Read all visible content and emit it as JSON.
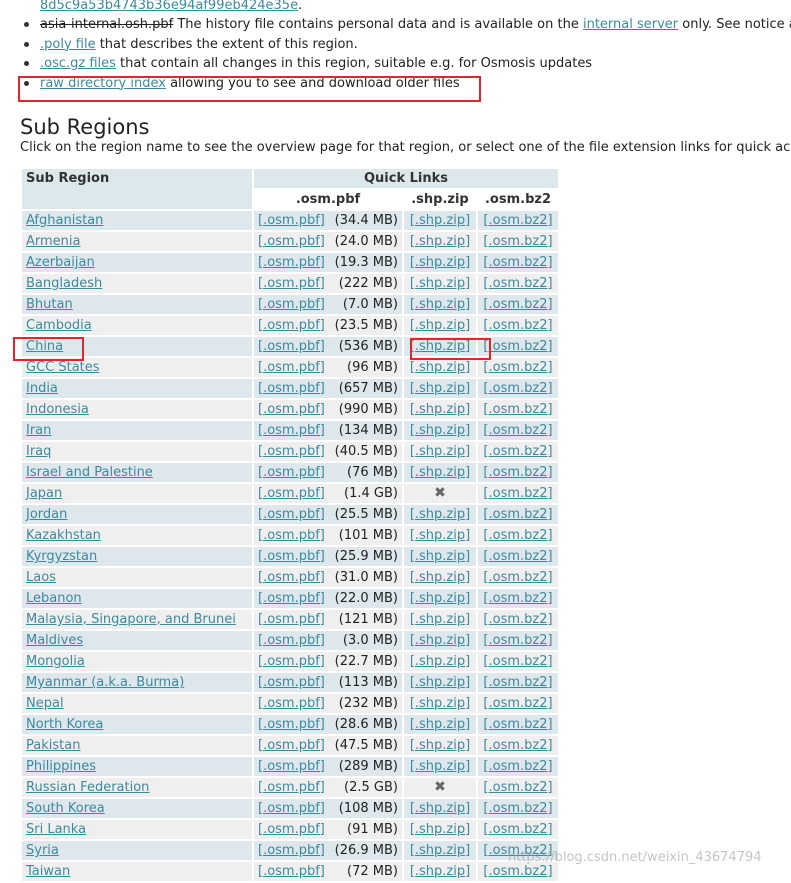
{
  "bullets": {
    "hash_line": "8d5c9a53b4743b36e94af99eb424e35e",
    "hash_period": ".",
    "history_file": "asia-internal.osh.pbf",
    "history_text_a": " The history file contains personal data and is available on the ",
    "internal_server": "internal server",
    "history_text_b": " only. See notice a",
    "poly_link": ".poly file",
    "poly_text": " that describes the extent of this region.",
    "osc_link": ".osc.gz files",
    "osc_text": " that contain all changes in this region, suitable e.g. for Osmosis updates",
    "raw_link": "raw directory index",
    "raw_text": " allowing you to see and download older files"
  },
  "heading": "Sub Regions",
  "intro": "Click on the region name to see the overview page for that region, or select one of the file extension links for quick acc",
  "table": {
    "col_sub_region": "Sub Region",
    "col_quick_links": "Quick Links",
    "col_pbf": ".osm.pbf",
    "col_shp": ".shp.zip",
    "col_bz2": ".osm.bz2",
    "pbf_link": "[.osm.pbf]",
    "shp_link": "[.shp.zip]",
    "bz2_link": "[.osm.bz2]",
    "rows": [
      {
        "name": "Afghanistan",
        "size": "(34.4 MB)",
        "shp": true
      },
      {
        "name": "Armenia",
        "size": "(24.0 MB)",
        "shp": true
      },
      {
        "name": "Azerbaijan",
        "size": "(19.3 MB)",
        "shp": true
      },
      {
        "name": "Bangladesh",
        "size": "(222 MB)",
        "shp": true
      },
      {
        "name": "Bhutan",
        "size": "(7.0 MB)",
        "shp": true
      },
      {
        "name": "Cambodia",
        "size": "(23.5 MB)",
        "shp": true
      },
      {
        "name": "China",
        "size": "(536 MB)",
        "shp": true
      },
      {
        "name": "GCC States",
        "size": "(96 MB)",
        "shp": true
      },
      {
        "name": "India",
        "size": "(657 MB)",
        "shp": true
      },
      {
        "name": "Indonesia",
        "size": "(990 MB)",
        "shp": true
      },
      {
        "name": "Iran",
        "size": "(134 MB)",
        "shp": true
      },
      {
        "name": "Iraq",
        "size": "(40.5 MB)",
        "shp": true
      },
      {
        "name": "Israel and Palestine",
        "size": "(76 MB)",
        "shp": true
      },
      {
        "name": "Japan",
        "size": "(1.4 GB)",
        "shp": false
      },
      {
        "name": "Jordan",
        "size": "(25.5 MB)",
        "shp": true
      },
      {
        "name": "Kazakhstan",
        "size": "(101 MB)",
        "shp": true
      },
      {
        "name": "Kyrgyzstan",
        "size": "(25.9 MB)",
        "shp": true
      },
      {
        "name": "Laos",
        "size": "(31.0 MB)",
        "shp": true
      },
      {
        "name": "Lebanon",
        "size": "(22.0 MB)",
        "shp": true
      },
      {
        "name": "Malaysia, Singapore, and Brunei",
        "size": "(121 MB)",
        "shp": true
      },
      {
        "name": "Maldives",
        "size": "(3.0 MB)",
        "shp": true
      },
      {
        "name": "Mongolia",
        "size": "(22.7 MB)",
        "shp": true
      },
      {
        "name": "Myanmar (a.k.a. Burma)",
        "size": "(113 MB)",
        "shp": true
      },
      {
        "name": "Nepal",
        "size": "(232 MB)",
        "shp": true
      },
      {
        "name": "North Korea",
        "size": "(28.6 MB)",
        "shp": true
      },
      {
        "name": "Pakistan",
        "size": "(47.5 MB)",
        "shp": true
      },
      {
        "name": "Philippines",
        "size": "(289 MB)",
        "shp": true
      },
      {
        "name": "Russian Federation",
        "size": "(2.5 GB)",
        "shp": false
      },
      {
        "name": "South Korea",
        "size": "(108 MB)",
        "shp": true
      },
      {
        "name": "Sri Lanka",
        "size": "(91 MB)",
        "shp": true
      },
      {
        "name": "Syria",
        "size": "(26.9 MB)",
        "shp": true
      },
      {
        "name": "Taiwan",
        "size": "(72 MB)",
        "shp": true
      }
    ]
  },
  "unavailable_mark": "✖",
  "watermark": "https://blog.csdn.net/weixin_43674794"
}
